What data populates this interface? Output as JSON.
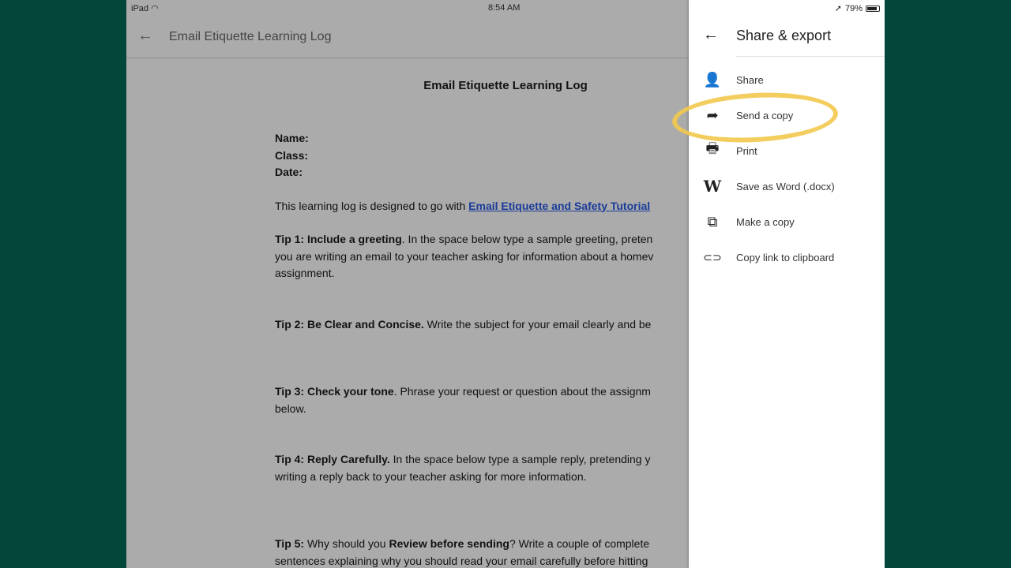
{
  "status": {
    "device": "iPad",
    "time": "8:54 AM",
    "battery": "79%"
  },
  "header": {
    "title": "Email Etiquette Learning Log"
  },
  "doc": {
    "title": "Email Etiquette Learning Log",
    "name": "Name:",
    "class": "Class:",
    "date": "Date:",
    "intro": "This learning log is designed to go with ",
    "intro_link": "Email Etiquette and Safety Tutorial",
    "tip1_b": "Tip 1: Include a greeting",
    "tip1": ". In the space below type a sample greeting, preten",
    "tip1_l2": "you are writing an email to your teacher asking for information about a homev",
    "tip1_l3": "assignment.",
    "tip2_b": "Tip 2: Be Clear and Concise.",
    "tip2": " Write the subject for your email clearly and be",
    "tip3_b": "Tip 3: Check your tone",
    "tip3": ". Phrase your request or question about the assignm",
    "tip3_l2": "below.",
    "tip4_b": "Tip 4: Reply Carefully.",
    "tip4": " In the space below type a sample reply, pretending y",
    "tip4_l2": "writing a reply back to your teacher asking for more information.",
    "tip5_a": "Tip 5:",
    "tip5_b": " Why should you ",
    "tip5_c": "Review before sending",
    "tip5_d": "? Write a couple of complete",
    "tip5_l2": "sentences explaining why you should read your email carefully before hitting"
  },
  "drawer": {
    "title": "Share & export",
    "items": [
      {
        "icon": "person-add-icon",
        "label": "Share"
      },
      {
        "icon": "forward-icon",
        "label": "Send a copy"
      },
      {
        "icon": "print-icon",
        "label": "Print"
      },
      {
        "icon": "word-icon",
        "label": "Save as Word (.docx)"
      },
      {
        "icon": "copy-icon",
        "label": "Make a copy"
      },
      {
        "icon": "link-icon",
        "label": "Copy link to clipboard"
      }
    ]
  },
  "colors": {
    "highlight": "#f2c94c",
    "background": "#03473a"
  }
}
